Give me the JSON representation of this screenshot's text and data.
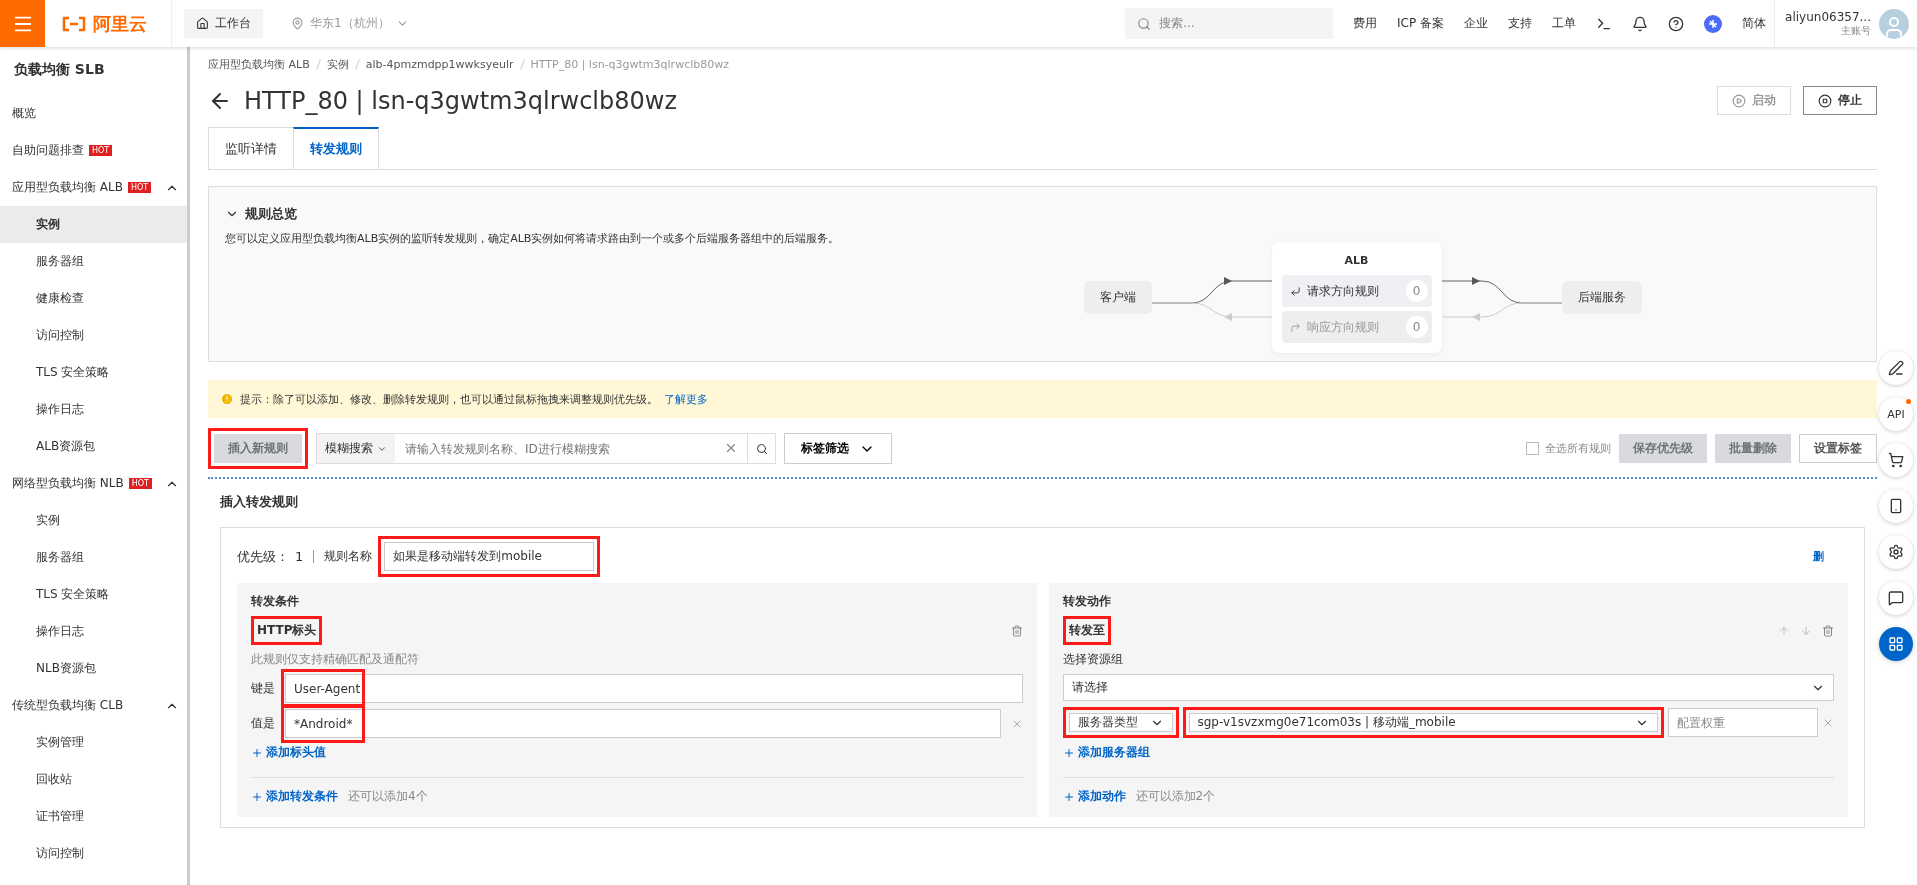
{
  "top_bar": {
    "logo": "阿里云",
    "workbench": "工作台",
    "region": "华东1（杭州）",
    "search_placeholder": "搜索...",
    "links": [
      "费用",
      "ICP 备案",
      "企业",
      "支持",
      "工单"
    ],
    "language": "简体",
    "account": {
      "name": "aliyun06357...",
      "role": "主账号"
    }
  },
  "sidebar": {
    "title": "负载均衡 SLB",
    "items": [
      {
        "label": "概览",
        "selected": false
      },
      {
        "label": "自助问题排查",
        "badge": "HOT",
        "selected": false
      },
      {
        "label": "应用型负载均衡 ALB",
        "badge": "HOT",
        "expanded": true,
        "children": [
          {
            "label": "实例",
            "selected": true
          },
          {
            "label": "服务器组",
            "selected": false
          },
          {
            "label": "健康检查",
            "selected": false
          },
          {
            "label": "访问控制",
            "selected": false
          },
          {
            "label": "TLS 安全策略",
            "selected": false
          },
          {
            "label": "操作日志",
            "selected": false
          },
          {
            "label": "ALB资源包",
            "selected": false
          }
        ]
      },
      {
        "label": "网络型负载均衡 NLB",
        "badge": "HOT",
        "expanded": true,
        "children": [
          {
            "label": "实例",
            "selected": false
          },
          {
            "label": "服务器组",
            "selected": false
          },
          {
            "label": "TLS 安全策略",
            "selected": false
          },
          {
            "label": "操作日志",
            "selected": false
          },
          {
            "label": "NLB资源包",
            "selected": false
          }
        ]
      },
      {
        "label": "传统型负载均衡 CLB",
        "expanded": true,
        "children": [
          {
            "label": "实例管理",
            "selected": false
          },
          {
            "label": "回收站",
            "selected": false
          },
          {
            "label": "证书管理",
            "selected": false
          },
          {
            "label": "访问控制",
            "selected": false
          }
        ]
      }
    ]
  },
  "breadcrumb": [
    "应用型负载均衡 ALB",
    "实例",
    "alb-4pmzmdpp1wwksyeulr",
    "HTTP_80 | lsn-q3gwtm3qlrwclb80wz"
  ],
  "title": "HTTP_80 | lsn-q3gwtm3qlrwclb80wz",
  "header_buttons": [
    {
      "kind": "start",
      "label": "启动",
      "disabled": true
    },
    {
      "kind": "stop",
      "label": "停止",
      "disabled": false
    }
  ],
  "tabs": [
    {
      "label": "监听详情",
      "selected": false
    },
    {
      "label": "转发规则",
      "selected": true
    }
  ],
  "overview": {
    "title": "规则总览",
    "expanded": true,
    "description": "您可以定义应用型负载均衡ALB实例的监听转发规则，确定ALB实例如何将请求路由到一个或多个后端服务器组中的后端服务。",
    "diagram": {
      "client": "客户端",
      "alb": "ALB",
      "rules": [
        {
          "label": "请求方向规则",
          "count": "0",
          "disabled": false
        },
        {
          "label": "响应方向规则",
          "count": "0",
          "disabled": true
        }
      ],
      "backend": "后端服务"
    }
  },
  "tip": {
    "text": "提示：除了可以添加、修改、删除转发规则，也可以通过鼠标拖拽来调整规则优先级。",
    "link": "了解更多"
  },
  "toolbar": {
    "insert_button": {
      "label": "插入新规则",
      "disabled": true,
      "highlighted": true
    },
    "search_mode": "模糊搜索",
    "search_placeholder": "请输入转发规则名称、ID进行模糊搜索",
    "tag_filter": "标签筛选",
    "select_all": {
      "label": "全选所有规则",
      "checked": false
    },
    "buttons": [
      {
        "label": "保存优先级",
        "disabled": true
      },
      {
        "label": "批量删除",
        "disabled": true
      },
      {
        "label": "设置标签",
        "disabled": false
      }
    ]
  },
  "insert_rule": {
    "heading": "插入转发规则",
    "priority_label": "优先级：",
    "priority": "1",
    "name_label": "规则名称",
    "name": {
      "value": "如果是移动端转发到mobile",
      "highlighted": true
    },
    "delete_link": "删",
    "conditions": {
      "title": "转发条件",
      "type": {
        "label": "HTTP标头",
        "highlighted": true
      },
      "hint": "此规则仅支持精确匹配及通配符",
      "key": {
        "label": "键是",
        "value": "User-Agent",
        "highlighted": true
      },
      "value": {
        "label": "值是",
        "value": "*Android*",
        "highlighted": true
      },
      "add_value": "添加标头值",
      "add_condition": "添加转发条件",
      "remaining": "还可以添加4个"
    },
    "actions": {
      "title": "转发动作",
      "type": {
        "label": "转发至",
        "highlighted": true
      },
      "resource_label": "选择资源组",
      "resource_placeholder": "请选择",
      "server_type": {
        "value": "服务器类型",
        "highlighted": true
      },
      "server_group": {
        "value": "sgp-v1svzxmg0e71com03s | 移动端_mobile",
        "highlighted": true
      },
      "weight_placeholder": "配置权重",
      "add_server_group": "添加服务器组",
      "add_action": "添加动作",
      "remaining": "还可以添加2个"
    }
  },
  "floating_tools": {
    "api_label": "API"
  }
}
